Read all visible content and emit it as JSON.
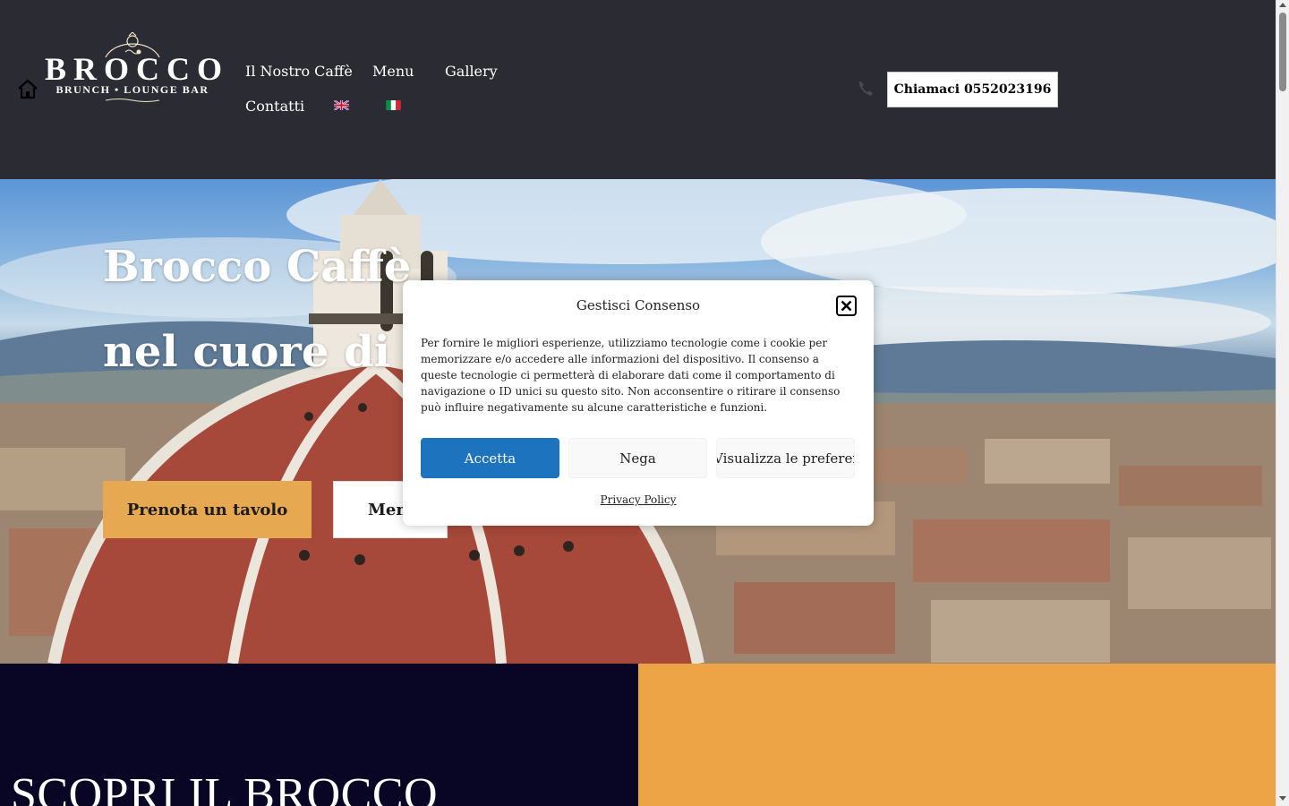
{
  "header": {
    "logo": {
      "brand": "BROCCO",
      "tagline_left": "BRUNCH",
      "tagline_sep": "•",
      "tagline_right": "LOUNGE BAR"
    },
    "nav": [
      {
        "label": "Il Nostro Caffè"
      },
      {
        "label": "Menu"
      },
      {
        "label": "Gallery"
      },
      {
        "label": "Contatti"
      }
    ],
    "languages": [
      "English",
      "Italiano"
    ],
    "call_button": "Chiamaci 0552023196"
  },
  "hero": {
    "title_line1": "Brocco Caffè",
    "title_line2": "nel cuore di Fi",
    "book_button": "Prenota un tavolo",
    "menu_button": "Menu"
  },
  "sections": {
    "dark_heading": "SCOPRI IL BROCCO"
  },
  "consent": {
    "title": "Gestisci Consenso",
    "body": "Per fornire le migliori esperienze, utilizziamo tecnologie come i cookie per memorizzare e/o accedere alle informazioni del dispositivo. Il consenso a queste tecnologie ci permetterà di elaborare dati come il comportamento di navigazione o ID unici su questo sito. Non acconsentire o ritirare il consenso può influire negativamente su alcune caratteristiche e funzioni.",
    "accept": "Accetta",
    "deny": "Nega",
    "preferences": "Visualizza le preferenze",
    "privacy_link": "Privacy Policy"
  },
  "colors": {
    "header_bg": "#2b2c33",
    "accent_orange": "#e7a852",
    "accept_blue": "#1e73be",
    "dark_section": "#080624"
  }
}
